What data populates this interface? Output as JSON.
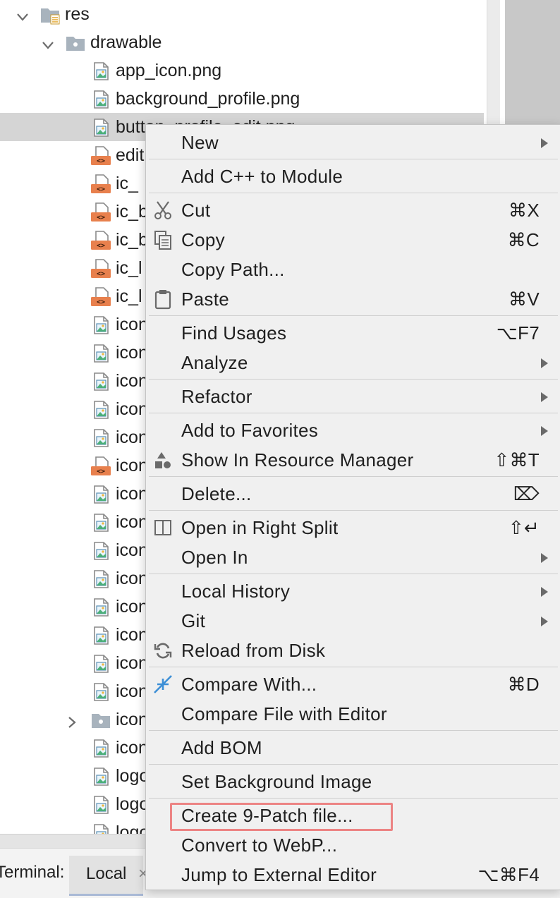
{
  "tree": {
    "rows": [
      {
        "label": "res",
        "type": "folder-res",
        "chevron": "down"
      },
      {
        "label": "drawable",
        "type": "folder",
        "chevron": "down"
      },
      {
        "label": "app_icon.png",
        "type": "image"
      },
      {
        "label": "background_profile.png",
        "type": "image"
      },
      {
        "label": "button_profile_edit.png",
        "type": "image",
        "selected": true
      },
      {
        "label": "edit",
        "type": "xml"
      },
      {
        "label": "ic_",
        "type": "xml"
      },
      {
        "label": "ic_b",
        "type": "xml"
      },
      {
        "label": "ic_b",
        "type": "xml"
      },
      {
        "label": "ic_l",
        "type": "xml"
      },
      {
        "label": "ic_l",
        "type": "xml"
      },
      {
        "label": "icon",
        "type": "image"
      },
      {
        "label": "icon",
        "type": "image"
      },
      {
        "label": "icon",
        "type": "image"
      },
      {
        "label": "icon",
        "type": "image"
      },
      {
        "label": "icon",
        "type": "image"
      },
      {
        "label": "icon",
        "type": "xml"
      },
      {
        "label": "icon",
        "type": "image"
      },
      {
        "label": "icon",
        "type": "image"
      },
      {
        "label": "icon",
        "type": "image"
      },
      {
        "label": "icon",
        "type": "image"
      },
      {
        "label": "icon",
        "type": "image"
      },
      {
        "label": "icon",
        "type": "image"
      },
      {
        "label": "icon",
        "type": "image"
      },
      {
        "label": "icon",
        "type": "image"
      },
      {
        "label": "icon",
        "type": "folder",
        "chevron": "right"
      },
      {
        "label": "icon",
        "type": "image"
      },
      {
        "label": "logo",
        "type": "image"
      },
      {
        "label": "logo",
        "type": "image"
      },
      {
        "label": "logo",
        "type": "image"
      }
    ]
  },
  "menu": {
    "items": [
      {
        "label": "New",
        "submenu": true
      },
      {
        "separator": true
      },
      {
        "label": "Add C++ to Module"
      },
      {
        "separator": true
      },
      {
        "label": "Cut",
        "shortcut": "⌘X",
        "icon": "scissors-icon"
      },
      {
        "label": "Copy",
        "shortcut": "⌘C",
        "icon": "copy-icon"
      },
      {
        "label": "Copy Path..."
      },
      {
        "label": "Paste",
        "shortcut": "⌘V",
        "icon": "clipboard-icon"
      },
      {
        "separator": true
      },
      {
        "label": "Find Usages",
        "shortcut": "⌥F7"
      },
      {
        "label": "Analyze",
        "submenu": true
      },
      {
        "separator": true
      },
      {
        "label": "Refactor",
        "submenu": true
      },
      {
        "separator": true
      },
      {
        "label": "Add to Favorites",
        "submenu": true
      },
      {
        "label": "Show In Resource Manager",
        "shortcut": "⇧⌘T",
        "icon": "resource-manager-icon"
      },
      {
        "separator": true
      },
      {
        "label": "Delete...",
        "shortcut": "⌦"
      },
      {
        "separator": true
      },
      {
        "label": "Open in Right Split",
        "shortcut": "⇧↵",
        "icon": "split-icon"
      },
      {
        "label": "Open In",
        "submenu": true
      },
      {
        "separator": true
      },
      {
        "label": "Local History",
        "submenu": true
      },
      {
        "label": "Git",
        "submenu": true
      },
      {
        "label": "Reload from Disk",
        "icon": "reload-icon"
      },
      {
        "separator": true
      },
      {
        "label": "Compare With...",
        "shortcut": "⌘D",
        "icon": "compare-icon"
      },
      {
        "label": "Compare File with Editor"
      },
      {
        "separator": true
      },
      {
        "label": "Add BOM"
      },
      {
        "separator": true
      },
      {
        "label": "Set Background Image"
      },
      {
        "separator": true
      },
      {
        "label": "Create 9-Patch file...",
        "highlighted": true
      },
      {
        "label": "Convert to WebP..."
      },
      {
        "label": "Jump to External Editor",
        "shortcut": "⌥⌘F4"
      }
    ]
  },
  "bottom": {
    "terminal_label": "Terminal:",
    "tab_label": "Local",
    "tab_close": "×"
  },
  "colors": {
    "highlight_border": "#ec8484",
    "selection_bg": "#d5d5d5",
    "menu_bg": "#f0f0f0",
    "xml_icon": "#e8804d",
    "compare_icon": "#3d8fd6"
  }
}
